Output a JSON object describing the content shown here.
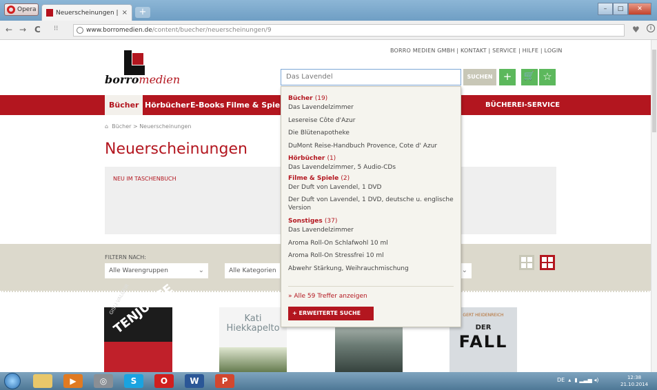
{
  "browser": {
    "opera_label": "Opera",
    "tab_title": "Neuerscheinungen | borro",
    "tab_close": "×",
    "new_tab": "+",
    "url_host": "www.borromedien.de",
    "url_path": "/content/buecher/neuerscheinungen/9",
    "nav": {
      "back": "←",
      "forward": "→",
      "reload": "C"
    }
  },
  "site": {
    "top_links": "BORRO MEDIEN GMBH | KONTAKT | SERVICE | HILFE | LOGIN",
    "logo_part1": "borro",
    "logo_part2": "medien",
    "search_value": "Das Lavendel",
    "search_button": "SUCHEN",
    "plus_button": "+",
    "cart_icon": "🛒",
    "star_icon": "☆",
    "nav": [
      {
        "label": "Bücher"
      },
      {
        "label": "Hörbücher"
      },
      {
        "label": "E-Books"
      },
      {
        "label": "Filme & Spiele"
      }
    ],
    "service": "BÜCHEREI-SERVICE",
    "breadcrumb": "Bücher > Neuerscheinungen",
    "page_title": "Neuerscheinungen",
    "promo_label": "NEU IM TASCHENBUCH",
    "filter_label": "FILTERN NACH:",
    "filter_selects": [
      "Alle Warengruppen",
      "Alle Kategorien"
    ],
    "chevron": "⌄"
  },
  "dropdown": {
    "categories": [
      {
        "name": "Bücher",
        "count": "(19)",
        "items": [
          "Das Lavendelzimmer",
          "Lesereise Côte d'Azur",
          "Die Blütenapotheke",
          "DuMont Reise-Handbuch Provence, Cote d' Azur"
        ]
      },
      {
        "name": "Hörbücher",
        "count": "(1)",
        "items": [
          "Das Lavendelzimmer, 5 Audio-CDs"
        ]
      },
      {
        "name": "Filme & Spiele",
        "count": "(2)",
        "items": [
          "Der Duft von Lavendel, 1 DVD",
          "Der Duft von Lavendel, 1 DVD, deutsche u. englische Version"
        ]
      },
      {
        "name": "Sonstiges",
        "count": "(37)",
        "items": [
          "Das Lavendelzimmer",
          "Aroma Roll-On Schlafwohl 10 ml",
          "Aroma Roll-On Stressfrei 10 ml",
          "Abwehr Stärkung, Weihrauchmischung"
        ]
      }
    ],
    "show_all": "» Alle 59 Treffer anzeigen",
    "advanced": "+ ERWEITERTE SUCHE"
  },
  "books": [
    {
      "author": "GISLI VALGEIR",
      "title": "TENJUNGE"
    },
    {
      "author": "Kati Hiekkapelto",
      "title": ""
    },
    {
      "author": "",
      "title": ""
    },
    {
      "author": "GERT HEIDENREICH",
      "title_small": "DER",
      "title": "FALL"
    }
  ],
  "taskbar": {
    "tray_lang": "DE",
    "time": "12:38",
    "date": "21.10.2014"
  },
  "colors": {
    "brand_red": "#b3161f",
    "green": "#5cb85c",
    "band": "#dcd9cc"
  }
}
